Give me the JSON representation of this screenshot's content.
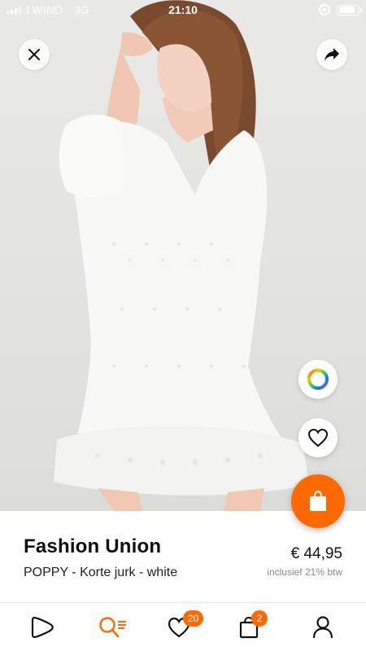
{
  "status_bar": {
    "carrier": "I WIND",
    "network": "3G",
    "time": "21:10",
    "battery_level": 0.85
  },
  "product": {
    "brand": "Fashion Union",
    "name": "POPPY - Korte jurk - white",
    "price": "€ 44,95",
    "vat_note": "inclusief 21% btw"
  },
  "nav": {
    "items": [
      {
        "name": "home",
        "icon": "zalando-logo-icon"
      },
      {
        "name": "search",
        "icon": "search-list-icon",
        "active": true
      },
      {
        "name": "wishlist",
        "icon": "heart-icon",
        "badge": "20"
      },
      {
        "name": "cart",
        "icon": "shopping-bag-icon",
        "badge": "2"
      },
      {
        "name": "account",
        "icon": "user-icon"
      }
    ]
  },
  "colors": {
    "accent": "#ff6a00",
    "active_icon": "#ff6a00",
    "icon": "#111111"
  }
}
